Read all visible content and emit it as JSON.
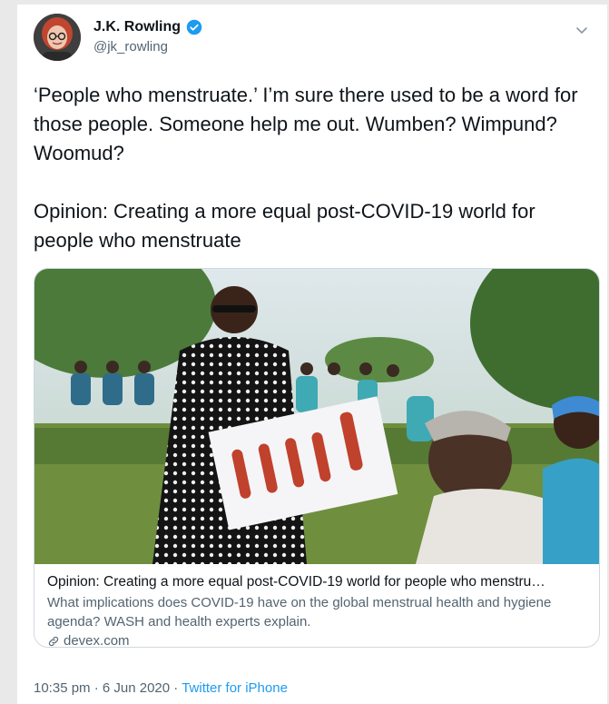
{
  "tweet": {
    "author": {
      "name": "J.K. Rowling",
      "handle": "@jk_rowling",
      "verified": true
    },
    "text": [
      "‘People who menstruate.’ I’m sure there used to be a word for those people. Someone help me out. Wumben? Wimpund? Woomud?",
      "Opinion: Creating a more equal post-COVID-19 world for people who menstruate"
    ],
    "card": {
      "title": "Opinion: Creating a more equal post-COVID-19 world for people who menstru…",
      "description": "What implications does COVID-19 have on the global menstrual health and hygiene agenda? WASH and health experts explain.",
      "domain": "devex.com"
    },
    "footer": {
      "time": "10:35 pm",
      "date": "6 Jun 2020",
      "app": "Twitter for iPhone",
      "separator": "·"
    }
  },
  "colors": {
    "accent": "#1d9bf0",
    "text": "#0f1419",
    "muted": "#536471",
    "border": "#cfd9de"
  },
  "icons": {
    "verified": "verified-badge-icon",
    "menu": "chevron-down-icon",
    "link": "link-icon"
  }
}
